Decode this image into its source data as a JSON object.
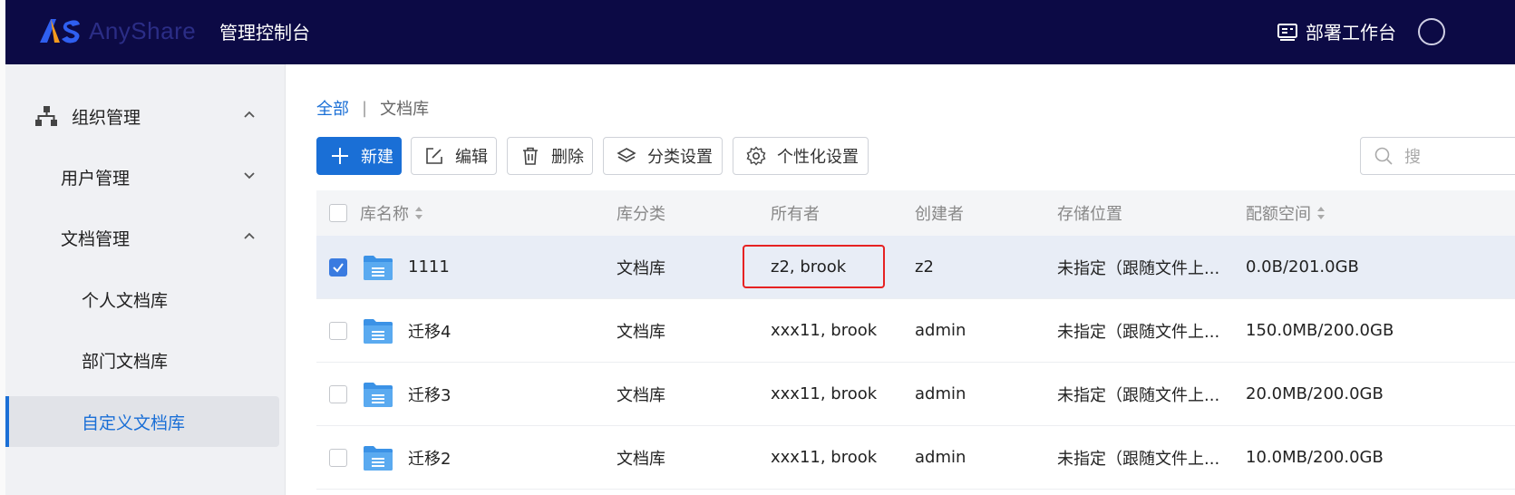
{
  "header": {
    "logo_text": "AnyShare",
    "console_title": "管理控制台",
    "deploy_label": "部署工作台",
    "colors": {
      "background": "#0c0a45",
      "logo_orange": "#f39a1e",
      "logo_blue": "#2f5ff0"
    }
  },
  "sidebar": {
    "items": [
      {
        "label": "组织管理",
        "icon": "org-tree-icon",
        "expanded": true
      },
      {
        "label": "用户管理",
        "expanded": false
      },
      {
        "label": "文档管理",
        "expanded": true
      },
      {
        "label": "个人文档库"
      },
      {
        "label": "部门文档库"
      },
      {
        "label": "自定义文档库",
        "active": true
      }
    ]
  },
  "breadcrumb": {
    "root": "全部",
    "separator": "|",
    "current": "文档库"
  },
  "toolbar": {
    "new_label": "新建",
    "edit_label": "编辑",
    "delete_label": "删除",
    "category_label": "分类设置",
    "personalize_label": "个性化设置",
    "search_placeholder": "搜"
  },
  "table": {
    "columns": {
      "name": "库名称",
      "category": "库分类",
      "owner": "所有者",
      "creator": "创建者",
      "storage": "存储位置",
      "quota": "配额空间"
    },
    "rows": [
      {
        "selected": true,
        "name": "1111",
        "category": "文档库",
        "owner": "z2, brook",
        "creator": "z2",
        "storage": "未指定（跟随文件上...",
        "quota": "0.0B/201.0GB"
      },
      {
        "selected": false,
        "name": "迁移4",
        "category": "文档库",
        "owner": "xxx11, brook",
        "creator": "admin",
        "storage": "未指定（跟随文件上...",
        "quota": "150.0MB/200.0GB"
      },
      {
        "selected": false,
        "name": "迁移3",
        "category": "文档库",
        "owner": "xxx11, brook",
        "creator": "admin",
        "storage": "未指定（跟随文件上...",
        "quota": "20.0MB/200.0GB"
      },
      {
        "selected": false,
        "name": "迁移2",
        "category": "文档库",
        "owner": "xxx11, brook",
        "creator": "admin",
        "storage": "未指定（跟随文件上...",
        "quota": "10.0MB/200.0GB"
      }
    ]
  },
  "colors": {
    "accent": "#1a6fd6",
    "highlight": "#e62222",
    "selected_row": "#e8edf6"
  }
}
